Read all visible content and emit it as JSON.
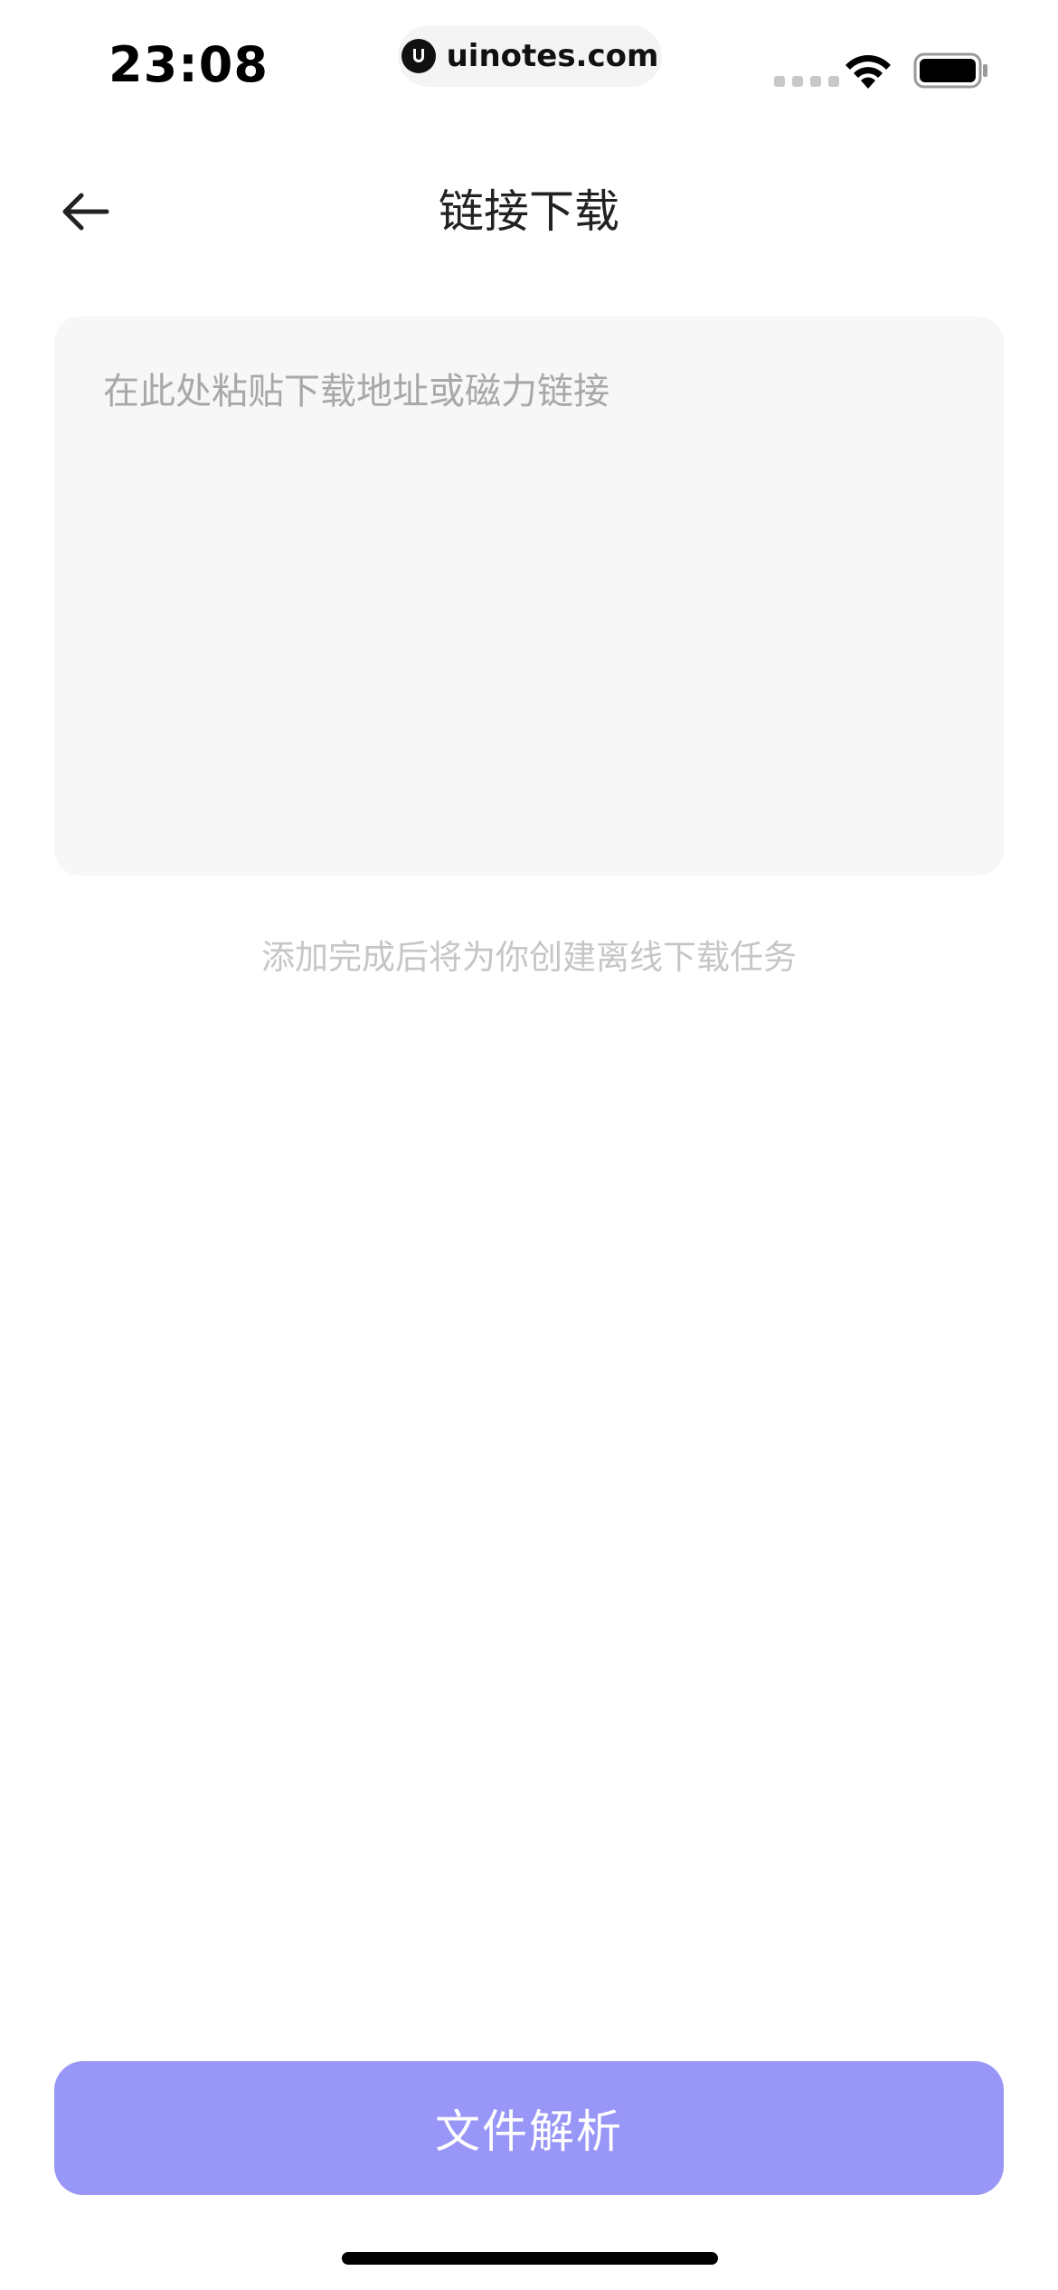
{
  "status_bar": {
    "time": "23:08",
    "url": "uinotes.com",
    "icons": [
      "cellular-signal-icon",
      "wifi-icon",
      "battery-icon"
    ]
  },
  "nav": {
    "title": "链接下载",
    "back_icon": "arrow-left-icon"
  },
  "link_input": {
    "placeholder": "在此处粘贴下载地址或磁力链接",
    "value": ""
  },
  "hint": "添加完成后将为你创建离线下载任务",
  "parse_button": {
    "label": "文件解析",
    "color": "#9896f7"
  }
}
